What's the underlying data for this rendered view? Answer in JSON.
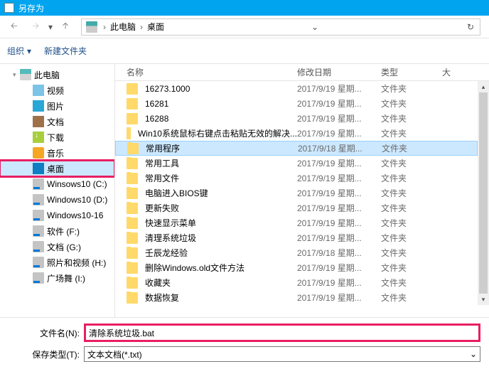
{
  "title": "另存为",
  "breadcrumb": {
    "pc": "此电脑",
    "desktop": "桌面"
  },
  "toolbar": {
    "organize": "组织",
    "newfolder": "新建文件夹"
  },
  "sidebar": [
    {
      "icon": "pc",
      "label": "此电脑",
      "expanded": true
    },
    {
      "icon": "video",
      "label": "视频",
      "child": true
    },
    {
      "icon": "pic",
      "label": "图片",
      "child": true
    },
    {
      "icon": "doc",
      "label": "文档",
      "child": true
    },
    {
      "icon": "dl",
      "label": "下载",
      "child": true
    },
    {
      "icon": "music",
      "label": "音乐",
      "child": true
    },
    {
      "icon": "desktop",
      "label": "桌面",
      "child": true,
      "selected": true
    },
    {
      "icon": "drive",
      "label": "Winsows10 (C:)",
      "child": true
    },
    {
      "icon": "drive",
      "label": "Windows10 (D:)",
      "child": true
    },
    {
      "icon": "drive",
      "label": "Windows10-16",
      "child": true
    },
    {
      "icon": "drive",
      "label": "软件 (F:)",
      "child": true
    },
    {
      "icon": "drive",
      "label": "文档 (G:)",
      "child": true
    },
    {
      "icon": "drive",
      "label": "照片和视频 (H:)",
      "child": true
    },
    {
      "icon": "drive",
      "label": "广场舞 (I:)",
      "child": true
    }
  ],
  "columns": {
    "name": "名称",
    "date": "修改日期",
    "type": "类型",
    "size": "大"
  },
  "files": [
    {
      "name": "16273.1000",
      "date": "2017/9/19 星期...",
      "type": "文件夹"
    },
    {
      "name": "16281",
      "date": "2017/9/19 星期...",
      "type": "文件夹"
    },
    {
      "name": "16288",
      "date": "2017/9/19 星期...",
      "type": "文件夹"
    },
    {
      "name": "Win10系统鼠标右键点击粘贴无效的解决...",
      "date": "2017/9/19 星期...",
      "type": "文件夹"
    },
    {
      "name": "常用程序",
      "date": "2017/9/18 星期...",
      "type": "文件夹",
      "selected": true
    },
    {
      "name": "常用工具",
      "date": "2017/9/19 星期...",
      "type": "文件夹"
    },
    {
      "name": "常用文件",
      "date": "2017/9/19 星期...",
      "type": "文件夹"
    },
    {
      "name": "电脑进入BIOS键",
      "date": "2017/9/19 星期...",
      "type": "文件夹"
    },
    {
      "name": "更新失败",
      "date": "2017/9/19 星期...",
      "type": "文件夹"
    },
    {
      "name": "快速显示菜单",
      "date": "2017/9/19 星期...",
      "type": "文件夹"
    },
    {
      "name": "清理系统垃圾",
      "date": "2017/9/19 星期...",
      "type": "文件夹"
    },
    {
      "name": "壬辰龙经验",
      "date": "2017/9/18 星期...",
      "type": "文件夹"
    },
    {
      "name": "删除Windows.old文件方法",
      "date": "2017/9/19 星期...",
      "type": "文件夹"
    },
    {
      "name": "收藏夹",
      "date": "2017/9/19 星期...",
      "type": "文件夹"
    },
    {
      "name": "数据恢复",
      "date": "2017/9/19 星期...",
      "type": "文件夹"
    }
  ],
  "form": {
    "filename_label": "文件名(N):",
    "filename_value": "清除系统垃圾.bat",
    "savetype_label": "保存类型(T):",
    "savetype_value": "文本文档(*.txt)"
  }
}
